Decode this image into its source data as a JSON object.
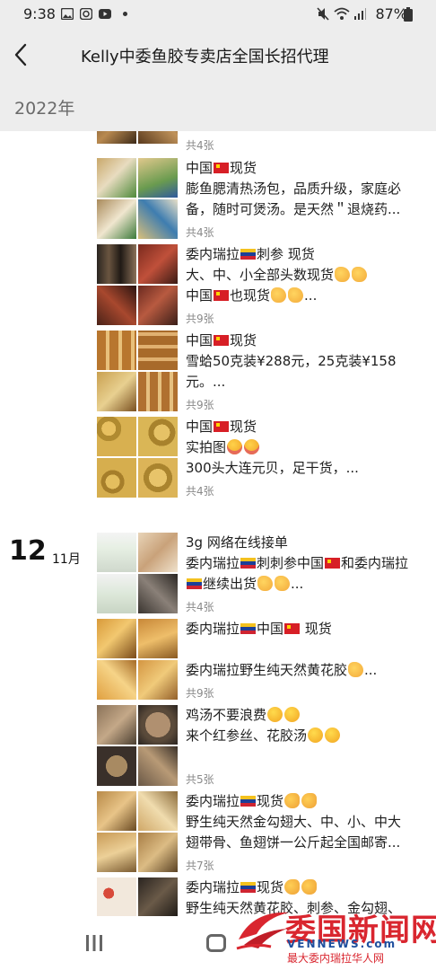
{
  "status_bar": {
    "time": "9:38",
    "battery": "87%",
    "icons": [
      "image-icon",
      "instagram-icon",
      "youtube-icon",
      "dot-icon",
      "mute-icon",
      "wifi-icon",
      "signal-icon",
      "battery-icon"
    ]
  },
  "header": {
    "title": "Kelly中委鱼胶专卖店全国长招代理",
    "back_icon": "back-arrow-icon"
  },
  "year_label": "2022年",
  "groups": [
    {
      "day": "",
      "month": "",
      "posts": [
        {
          "lines": [],
          "count": "共4张"
        },
        {
          "lines": [
            "中国🇨🇳现货",
            "膨鱼腮清热汤包，品质升级，家庭必",
            "备，随时可煲汤。是天然＂退烧药..."
          ],
          "count": "共4张"
        },
        {
          "lines": [
            "委内瑞拉🇻🇪刺参 现货",
            "大、中、小全部头数现货🤝🤝",
            "中国🇨🇳也现货🤝🤝..."
          ],
          "count": "共9张"
        },
        {
          "lines": [
            "中国🇨🇳现货",
            "雪蛤50克装¥288元，25克装¥158",
            "元。..."
          ],
          "count": "共9张"
        },
        {
          "lines": [
            "中国🇨🇳现货",
            "实拍图😍😍",
            "300头大连元贝，足干货，..."
          ],
          "count": "共4张"
        }
      ]
    },
    {
      "day": "12",
      "month": "11月",
      "posts": [
        {
          "lines": [
            "3g 网络在线接单",
            "委内瑞拉🇻🇪刺刺参中国🇨🇳和委内瑞拉",
            "🇻🇪继续出货🤝🤝..."
          ],
          "count": "共4张"
        },
        {
          "lines": [
            "委内瑞拉🇻🇪中国🇨🇳 现货",
            "",
            "委内瑞拉野生纯天然黄花胶🤝..."
          ],
          "count": "共9张"
        },
        {
          "lines": [
            "鸡汤不要浪费😁😁",
            "来个红参丝、花胶汤🥴🥴"
          ],
          "count": "共5张"
        },
        {
          "lines": [
            "委内瑞拉🇻🇪现货💪💪",
            "野生纯天然金勾翅大、中、小、中大",
            "翅带骨、鱼翅饼一公斤起全国邮寄..."
          ],
          "count": "共7张"
        },
        {
          "lines": [
            "委内瑞拉🇻🇪现货💪💪",
            "野生纯天然黄花胶、刺参、金勾翅、"
          ],
          "count": ""
        }
      ]
    }
  ],
  "watermark": {
    "title": "委国新闻网",
    "url": "VENNEWS.com",
    "subtitle": "最大委内瑞拉华人网"
  },
  "colors": {
    "header_bg": "#ededed",
    "feed_bg": "#ffffff",
    "watermark_red": "#d9262f",
    "watermark_blue": "#1f4f9e"
  }
}
